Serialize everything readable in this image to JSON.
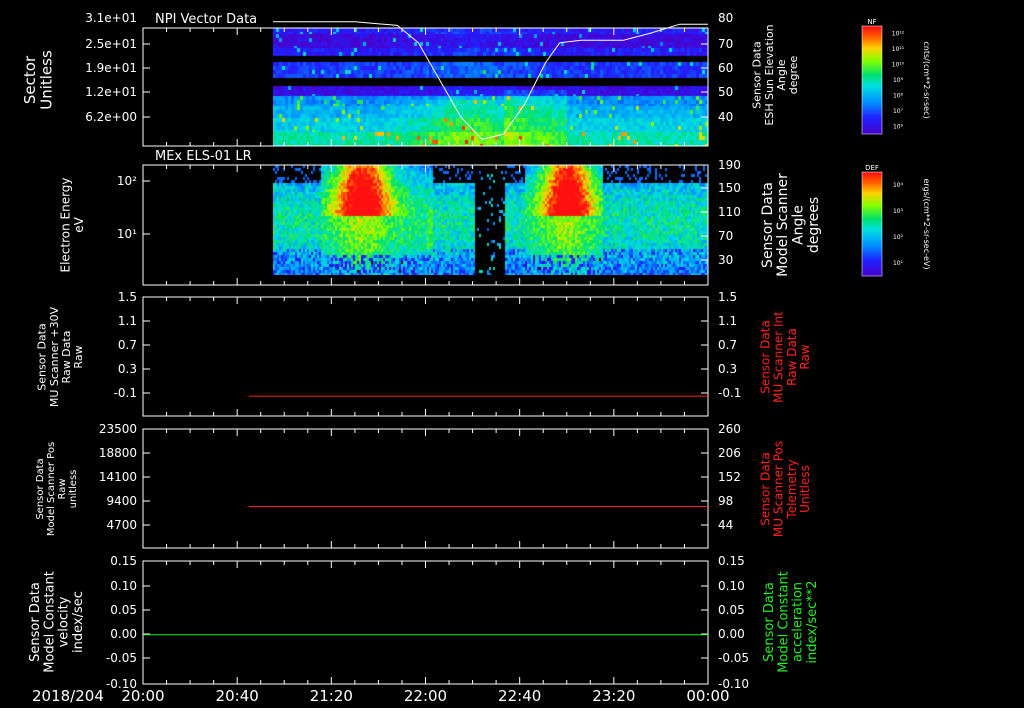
{
  "date_label": "2018/204",
  "time_ticks": [
    "20:00",
    "20:40",
    "21:20",
    "22:00",
    "22:40",
    "23:20",
    "00:00"
  ],
  "colors": {
    "red": "#ff2020",
    "green": "#22ee22",
    "white": "#ffffff",
    "frame": "#ffffff"
  },
  "colorbars": [
    {
      "top_label": "NF",
      "unit": "cnts/(cm**2-sr-sec)",
      "ticks": [
        "10¹²",
        "10¹¹",
        "10¹⁰",
        "10⁹",
        "10⁸",
        "10⁷",
        "10⁶"
      ]
    },
    {
      "top_label": "DEF",
      "unit": "ergs/(cm**2-sr-sec-eV)",
      "ticks": [
        "10⁴",
        "10³",
        "10²",
        "10¹"
      ]
    }
  ],
  "chart_data": [
    {
      "type": "heatmap",
      "title": "NPI Vector Data",
      "ylabel": "Sector Unitless",
      "y_ticks": [
        "3.1e+01",
        "2.5e+01",
        "1.9e+01",
        "1.2e+01",
        "6.2e+00"
      ],
      "y2label": "Sensor Data ESH Sun Elevation Angle degree",
      "y2_ticks": [
        "80",
        "70",
        "60",
        "50",
        "40"
      ],
      "y2lim": [
        30,
        80
      ],
      "data_start_time": "20:55",
      "overlay_line": {
        "color": "white",
        "points": [
          [
            20.92,
            78.5
          ],
          [
            21.5,
            78.5
          ],
          [
            21.8,
            77
          ],
          [
            21.95,
            70
          ],
          [
            22.1,
            55
          ],
          [
            22.25,
            40
          ],
          [
            22.4,
            31
          ],
          [
            22.55,
            33
          ],
          [
            22.7,
            45
          ],
          [
            22.85,
            62
          ],
          [
            22.95,
            70
          ],
          [
            23.1,
            71
          ],
          [
            23.4,
            71
          ],
          [
            23.6,
            74
          ],
          [
            23.8,
            77.5
          ],
          [
            24.0,
            77.5
          ]
        ]
      }
    },
    {
      "type": "heatmap",
      "title": "MEx ELS-01 LR",
      "ylabel": "Electron Energy eV",
      "y_ticks": [
        "10²",
        "10¹"
      ],
      "y2label": "Sensor Data Model Scanner Angle degrees",
      "y2_ticks": [
        "190",
        "150",
        "110",
        "70",
        "30"
      ],
      "data_start_time": "20:55"
    },
    {
      "type": "line",
      "ylabel": "Sensor Data MU Scanner +30V Raw Data Raw",
      "y_ticks": [
        "1.5",
        "1.1",
        "0.7",
        "0.3",
        "-0.1"
      ],
      "ylim": [
        -0.3,
        1.5
      ],
      "y2label": "Sensor Data MU Scanner Int Raw Data Raw",
      "y2_ticks": [
        "1.5",
        "1.1",
        "0.7",
        "0.3",
        "-0.1"
      ],
      "series": [
        {
          "color": "red",
          "x_start": 20.75,
          "x_end": 24.0,
          "value": 0.0
        }
      ]
    },
    {
      "type": "line",
      "ylabel": "Sensor Data Model Scanner Pos Raw unitless",
      "y_ticks": [
        "23500",
        "18800",
        "14100",
        "9400",
        "4700"
      ],
      "ylim": [
        0,
        23500
      ],
      "y2label": "Sensor Data MU Scanner Pos Telemetry Unitless",
      "y2_ticks": [
        "260",
        "206",
        "152",
        "98",
        "44"
      ],
      "series": [
        {
          "color": "red",
          "x_start": 20.75,
          "x_end": 24.0,
          "value": 8200
        }
      ]
    },
    {
      "type": "line",
      "ylabel": "Sensor Data Model Constant velocity index/sec",
      "y_ticks": [
        "0.15",
        "0.10",
        "0.05",
        "0.00",
        "-0.05",
        "-0.10"
      ],
      "ylim": [
        -0.1,
        0.15
      ],
      "y2label": "Sensor Data Model Constant acceleration index/sec**2",
      "y2_ticks": [
        "0.15",
        "0.10",
        "0.05",
        "0.00",
        "-0.05",
        "-0.10"
      ],
      "series": [
        {
          "color": "green",
          "x_start": 20.0,
          "x_end": 24.0,
          "value": 0.0
        }
      ]
    }
  ]
}
